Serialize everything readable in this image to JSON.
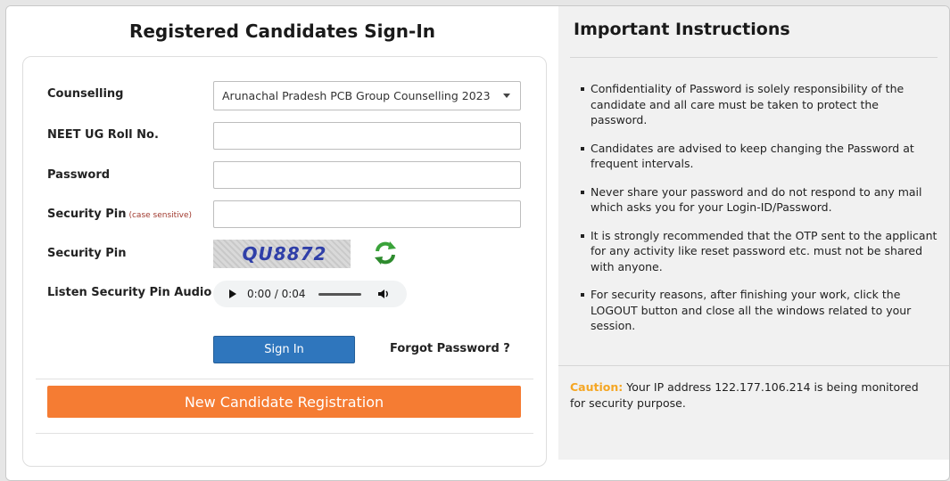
{
  "signin": {
    "title": "Registered Candidates Sign-In",
    "counselling_label": "Counselling",
    "counselling_selected": "Arunachal Pradesh PCB Group Counselling 2023",
    "roll_label": "NEET UG Roll No.",
    "roll_value": "",
    "password_label": "Password",
    "password_value": "",
    "pin_label": "Security Pin",
    "pin_hint": "(case sensitive)",
    "pin_value": "",
    "captcha_label": "Security Pin",
    "captcha_text": "QU8872",
    "audio_label": "Listen Security Pin Audio",
    "audio_time": "0:00 / 0:04",
    "signin_button": "Sign In",
    "forgot_link": "Forgot Password ?",
    "register_button": "New Candidate Registration"
  },
  "instructions": {
    "title": "Important Instructions",
    "items": [
      "Confidentiality of Password is solely responsibility of the candidate and all care must be taken to protect the password.",
      "Candidates are advised to keep changing the Password at frequent intervals.",
      "Never share your password and do not respond to any mail which asks you for your Login-ID/Password.",
      "It is strongly recommended that the OTP sent to the applicant for any activity like reset password etc. must not be shared with anyone.",
      "For security reasons, after finishing your work, click the LOGOUT button and close all the windows related to your session."
    ],
    "caution_label": "Caution:",
    "caution_text": "Your IP address 122.177.106.214 is being monitored for security purpose."
  },
  "colors": {
    "primary_button": "#2f76bd",
    "register_button": "#f57c33",
    "caution": "#f5a623",
    "panel_bg": "#f1f1f1"
  },
  "icons": {
    "refresh": "refresh-captcha-icon",
    "dropdown": "chevron-down-icon",
    "play": "play-icon",
    "volume": "volume-icon"
  }
}
